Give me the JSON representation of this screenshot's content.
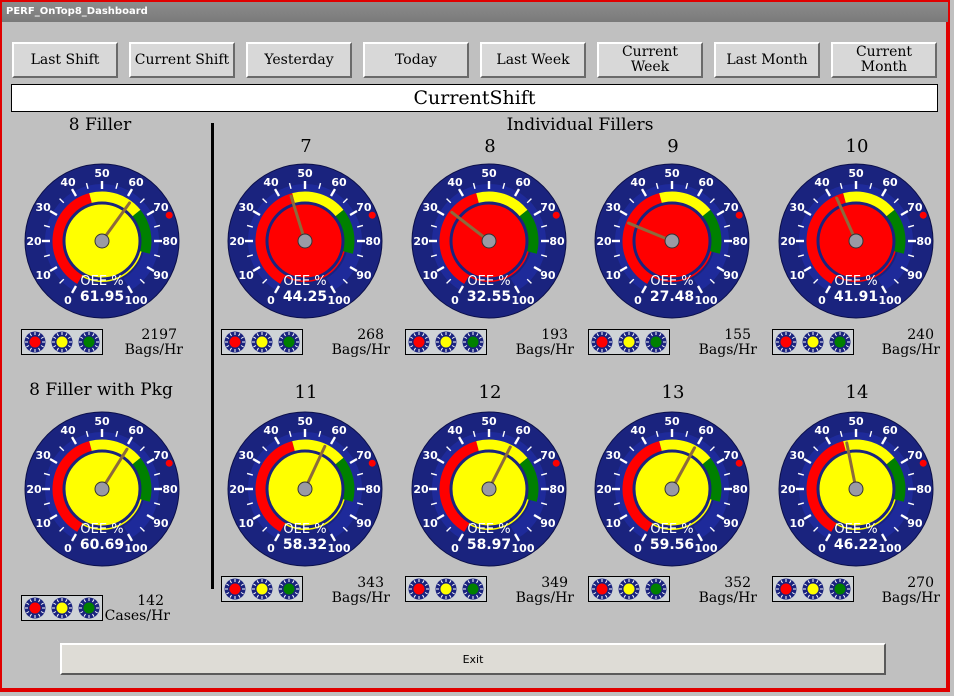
{
  "window": {
    "title": "PERF_OnTop8_Dashboard"
  },
  "buttons": [
    {
      "label": "Last Shift"
    },
    {
      "label": "Current Shift"
    },
    {
      "label": "Yesterday"
    },
    {
      "label": "Today"
    },
    {
      "label": "Last Week"
    },
    {
      "label": "Current\nWeek"
    },
    {
      "label": "Last Month"
    },
    {
      "label": "Current\nMonth"
    }
  ],
  "current_period": "CurrentShift",
  "left_panel": {
    "title_top": "8 Filler",
    "title_bottom": "8 Filler with Pkg"
  },
  "individual_title": "Individual Fillers",
  "gauge": {
    "scale_labels": [
      "0",
      "10",
      "20",
      "30",
      "40",
      "50",
      "60",
      "70",
      "80",
      "90",
      "100"
    ],
    "caption": "OEE %",
    "colors": {
      "face": "#1a237e",
      "red": "#ff0000",
      "yellow": "#ffff00",
      "green": "#008000",
      "needle": "#8c6a3c",
      "target": "#ff0000"
    },
    "bands": {
      "red_to": 45,
      "yellow_to": 67,
      "green_to": 85
    },
    "target": 73
  },
  "gauges": [
    {
      "title": "",
      "oee": "61.95",
      "value": 61.95,
      "rate": "2197",
      "unit": "Bags/Hr"
    },
    {
      "title": "",
      "oee": "60.69",
      "value": 60.69,
      "rate": "142",
      "unit": "Cases/Hr"
    },
    {
      "title": "7",
      "oee": "44.25",
      "value": 44.25,
      "rate": "268",
      "unit": "Bags/Hr"
    },
    {
      "title": "8",
      "oee": "32.55",
      "value": 32.55,
      "rate": "193",
      "unit": "Bags/Hr"
    },
    {
      "title": "9",
      "oee": "27.48",
      "value": 27.48,
      "rate": "155",
      "unit": "Bags/Hr"
    },
    {
      "title": "10",
      "oee": "41.91",
      "value": 41.91,
      "rate": "240",
      "unit": "Bags/Hr"
    },
    {
      "title": "11",
      "oee": "58.32",
      "value": 58.32,
      "rate": "343",
      "unit": "Bags/Hr"
    },
    {
      "title": "12",
      "oee": "58.97",
      "value": 58.97,
      "rate": "349",
      "unit": "Bags/Hr"
    },
    {
      "title": "13",
      "oee": "59.56",
      "value": 59.56,
      "rate": "352",
      "unit": "Bags/Hr"
    },
    {
      "title": "14",
      "oee": "46.22",
      "value": 46.22,
      "rate": "270",
      "unit": "Bags/Hr"
    }
  ],
  "exit_label": "Exit"
}
